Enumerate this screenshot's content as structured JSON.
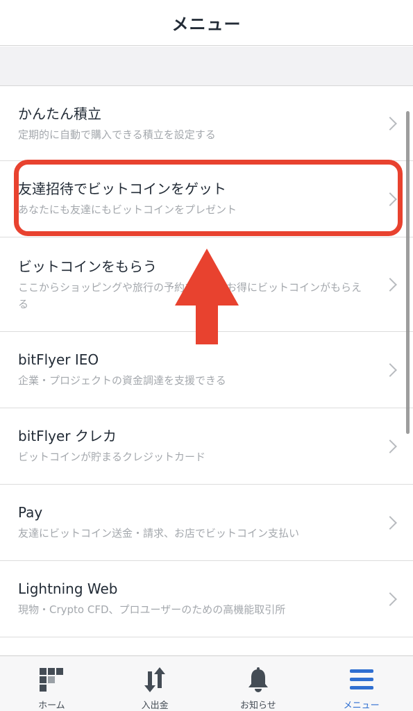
{
  "header": {
    "title": "メニュー"
  },
  "menu": {
    "items": [
      {
        "title": "かんたん積立",
        "desc": "定期的に自動で購入できる積立を設定する"
      },
      {
        "title": "友達招待でビットコインをゲット",
        "desc": "あなたにも友達にもビットコインをプレゼント"
      },
      {
        "title": "ビットコインをもらう",
        "desc": "ここからショッピングや旅行の予約をするとお得にビットコインがもらえる"
      },
      {
        "title": "bitFlyer IEO",
        "desc": "企業・プロジェクトの資金調達を支援できる"
      },
      {
        "title": "bitFlyer クレカ",
        "desc": "ビットコインが貯まるクレジットカード"
      },
      {
        "title": "Pay",
        "desc": "友達にビットコイン送金・請求、お店でビットコイン支払い"
      },
      {
        "title": "Lightning Web",
        "desc": "現物・Crypto CFD、プロユーザーのための高機能取引所"
      }
    ]
  },
  "tabs": [
    {
      "label": "ホーム",
      "icon": "home-grid-icon"
    },
    {
      "label": "入出金",
      "icon": "transfer-arrows-icon"
    },
    {
      "label": "お知らせ",
      "icon": "bell-icon"
    },
    {
      "label": "メニュー",
      "icon": "hamburger-menu-icon"
    }
  ],
  "colors": {
    "accent": "#2f6fd1",
    "highlight": "#e8422f",
    "text": "#222b36",
    "subtext": "#a4a8ad"
  }
}
